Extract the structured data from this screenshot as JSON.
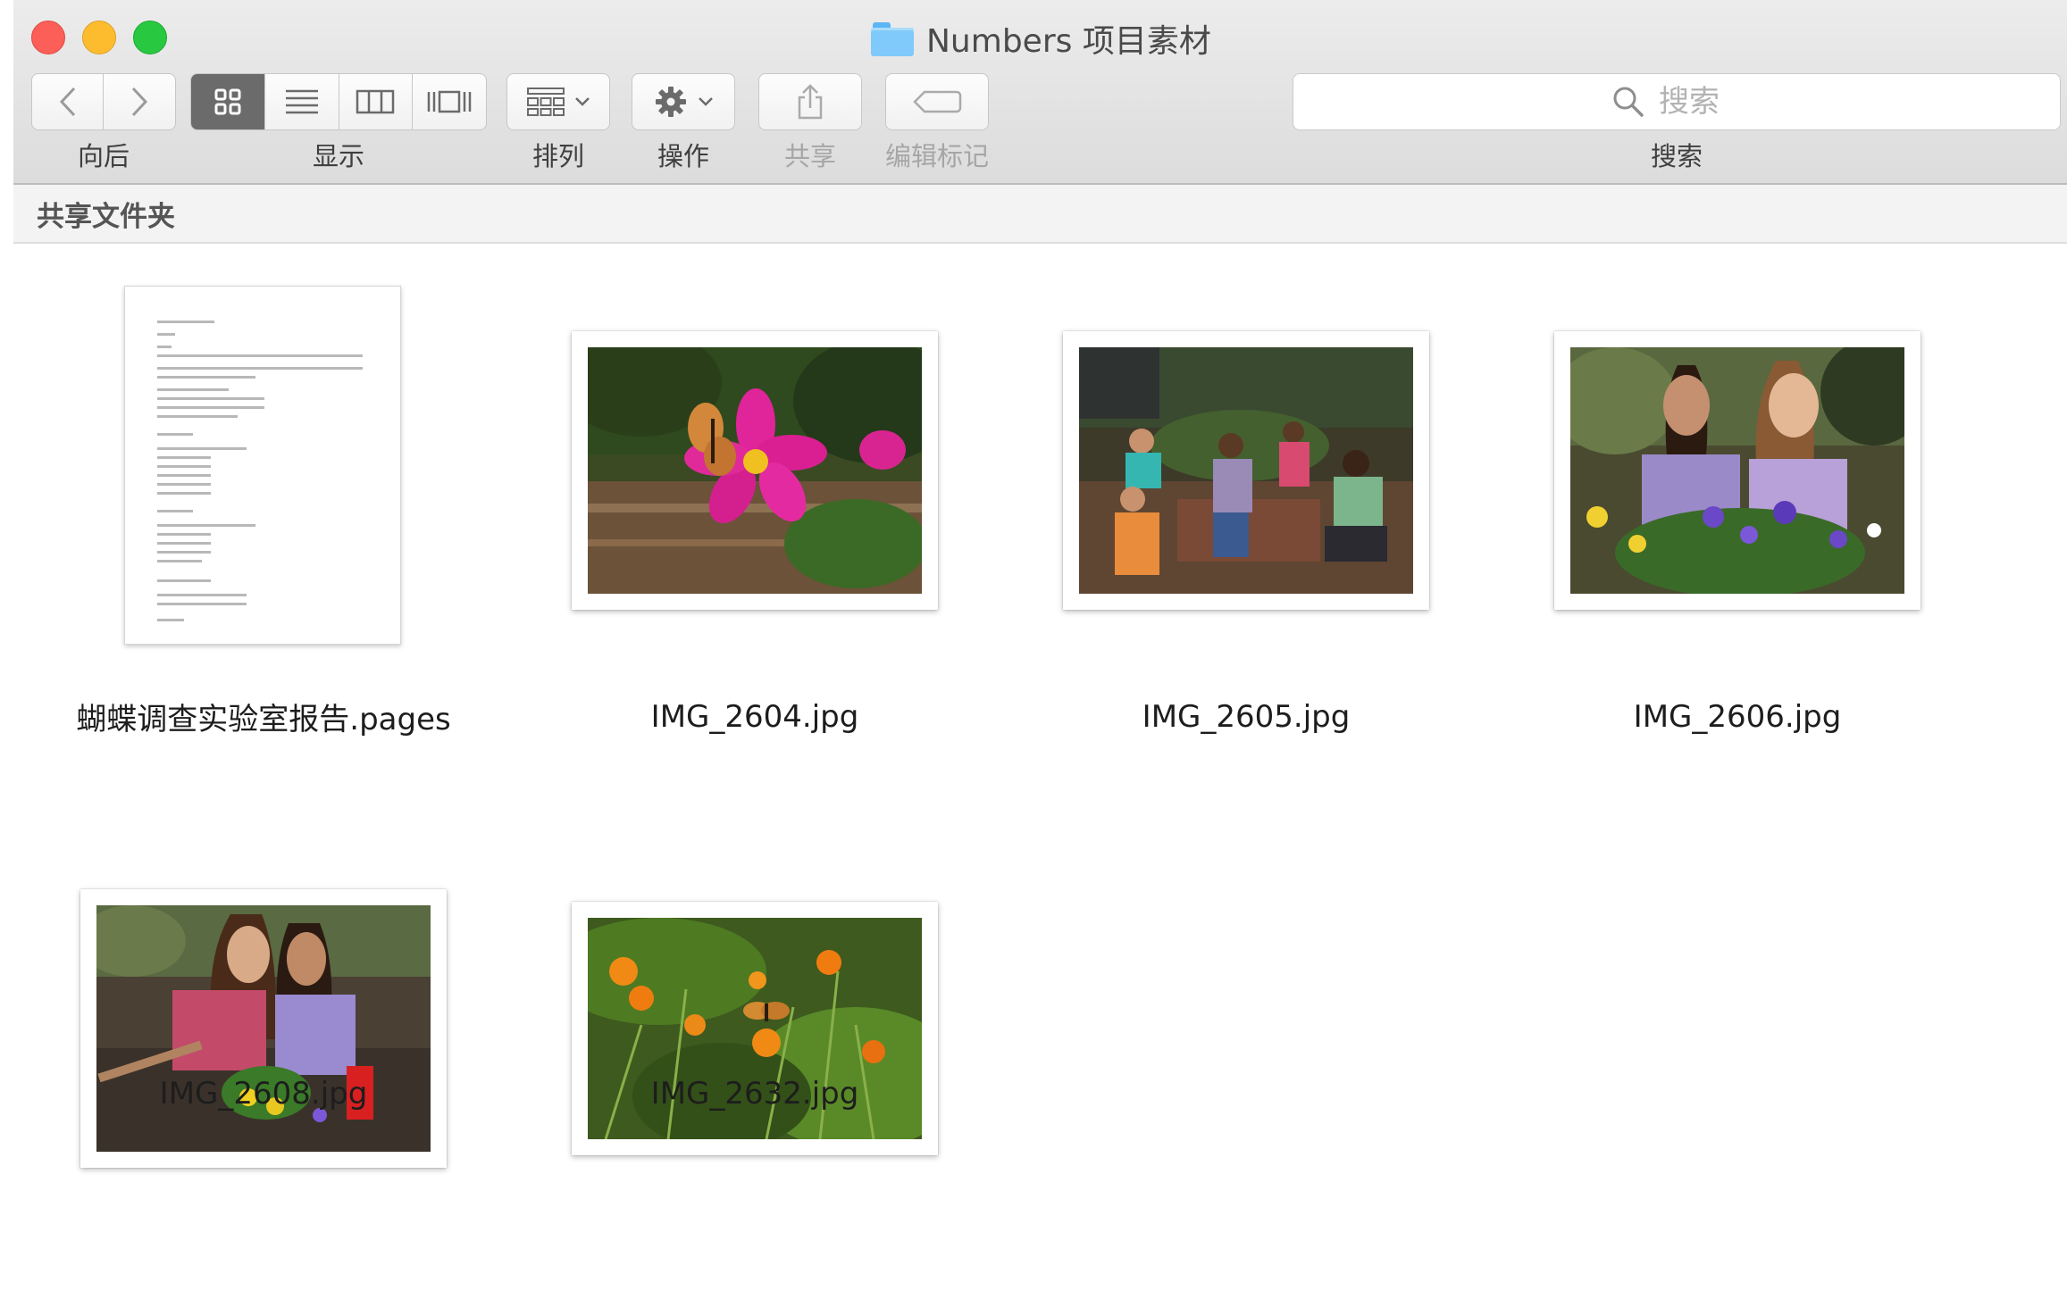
{
  "window": {
    "title": "Numbers 项目素材"
  },
  "toolbar": {
    "back_label": "向后",
    "view_label": "显示",
    "arrange_label": "排列",
    "action_label": "操作",
    "share_label": "共享",
    "tags_label": "编辑标记",
    "search_label": "搜索",
    "search_placeholder": "搜索",
    "active_view": "icon"
  },
  "pathbar": {
    "label": "共享文件夹"
  },
  "files": [
    {
      "name": "蝴蝶调查实验室报告.pages",
      "kind": "document"
    },
    {
      "name": "IMG_2604.jpg",
      "kind": "photo"
    },
    {
      "name": "IMG_2605.jpg",
      "kind": "photo"
    },
    {
      "name": "IMG_2606.jpg",
      "kind": "photo"
    },
    {
      "name": "IMG_2608.jpg",
      "kind": "photo"
    },
    {
      "name": "IMG_2632.jpg",
      "kind": "photo"
    }
  ],
  "colors": {
    "close": "#fc5f57",
    "minimize": "#fdbc2e",
    "zoom": "#28c840",
    "folder": "#7fcafa"
  }
}
